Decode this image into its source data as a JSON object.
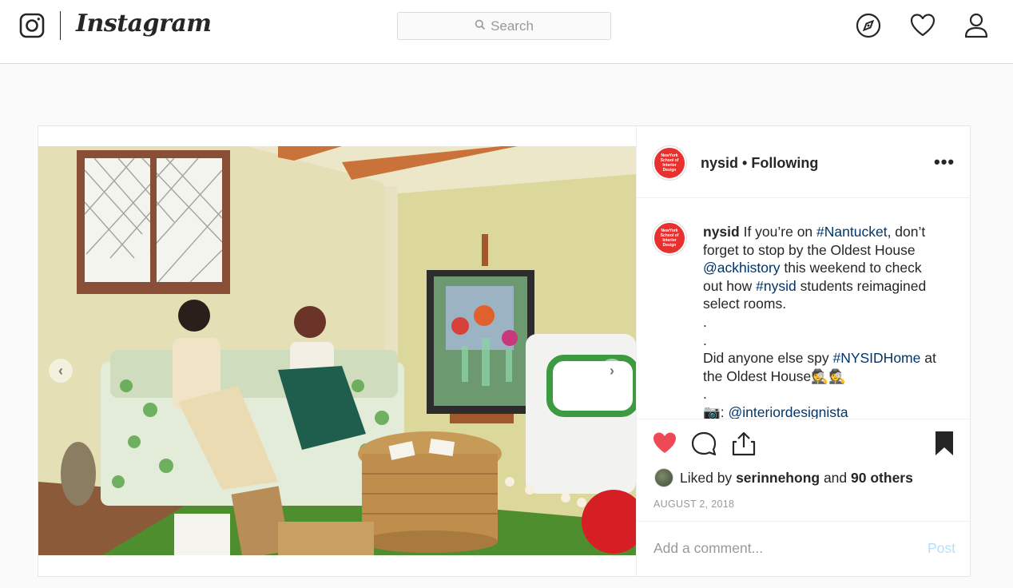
{
  "nav": {
    "logo_text": "Instagram",
    "search_placeholder": "Search",
    "icons": [
      "instagram-glyph-icon",
      "compass-icon",
      "heart-icon",
      "user-icon"
    ]
  },
  "post": {
    "username": "nysid",
    "separator": "•",
    "follow_status": "Following",
    "more_label": "•••",
    "avatar_text": [
      "NewYork",
      "School of",
      "Interior",
      "Design"
    ],
    "caption": {
      "username": "nysid",
      "t1": " If you’re on ",
      "tag_nantucket": "#Nantucket",
      "t2": ", don’t forget to stop by the Oldest House ",
      "mention_ack": "@ackhistory",
      "t3": " this weekend to check out how ",
      "tag_nysid": "#nysid",
      "t4": " students reimagined select rooms.",
      "dot1": ".",
      "dot2": ".",
      "t5": "Did anyone else spy ",
      "tag_home": "#NYSIDHome",
      "t6": " at the Oldest House🕵🕵",
      "dot3": ".",
      "camera": "📷: ",
      "mention_photo": "@interiordesignista"
    },
    "likes": {
      "prefix": "Liked by ",
      "user": "serinnehong",
      "middle": " and ",
      "count": "90 others"
    },
    "date": "AUGUST 2, 2018",
    "comment_placeholder": "Add a comment...",
    "post_label": "Post",
    "liked": true,
    "colors": {
      "like_red": "#ed4956",
      "link_blue": "#003569",
      "post_disabled": "#b2dffc",
      "avatar_red": "#e8312f"
    }
  }
}
